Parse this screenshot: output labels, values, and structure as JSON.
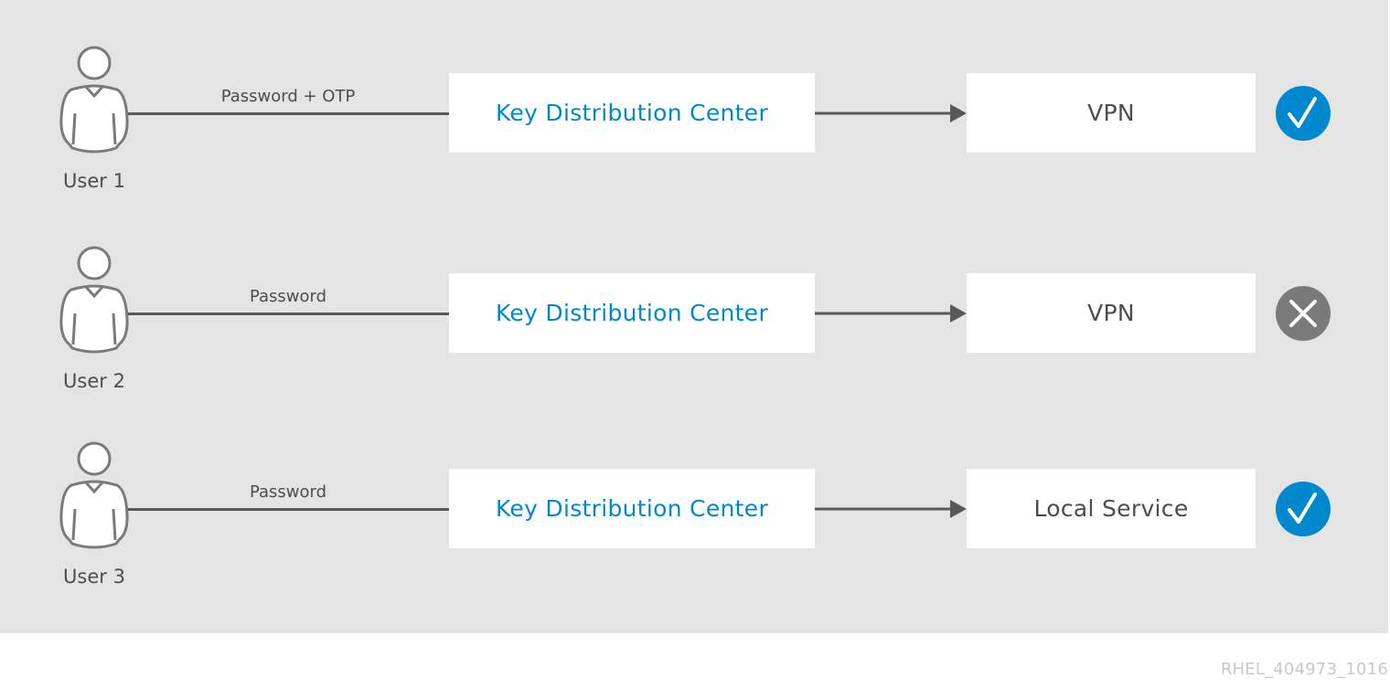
{
  "diagram": {
    "rows": [
      {
        "user": "User 1",
        "credential": "Password + OTP",
        "kdc": "Key Distribution Center",
        "service": "VPN",
        "status": "success",
        "status_icon": "check-icon"
      },
      {
        "user": "User 2",
        "credential": "Password",
        "kdc": "Key Distribution Center",
        "service": "VPN",
        "status": "denied",
        "status_icon": "x-icon"
      },
      {
        "user": "User 3",
        "credential": "Password",
        "kdc": "Key Distribution Center",
        "service": "Local Service",
        "status": "success",
        "status_icon": "check-icon"
      }
    ],
    "footer_id": "RHEL_404973_1016"
  },
  "colors": {
    "background": "#e4e4e4",
    "accent_blue": "#0088ce",
    "denied_gray": "#7a7a7a",
    "line_gray": "#595959",
    "text_gray": "#4d4d4d"
  }
}
